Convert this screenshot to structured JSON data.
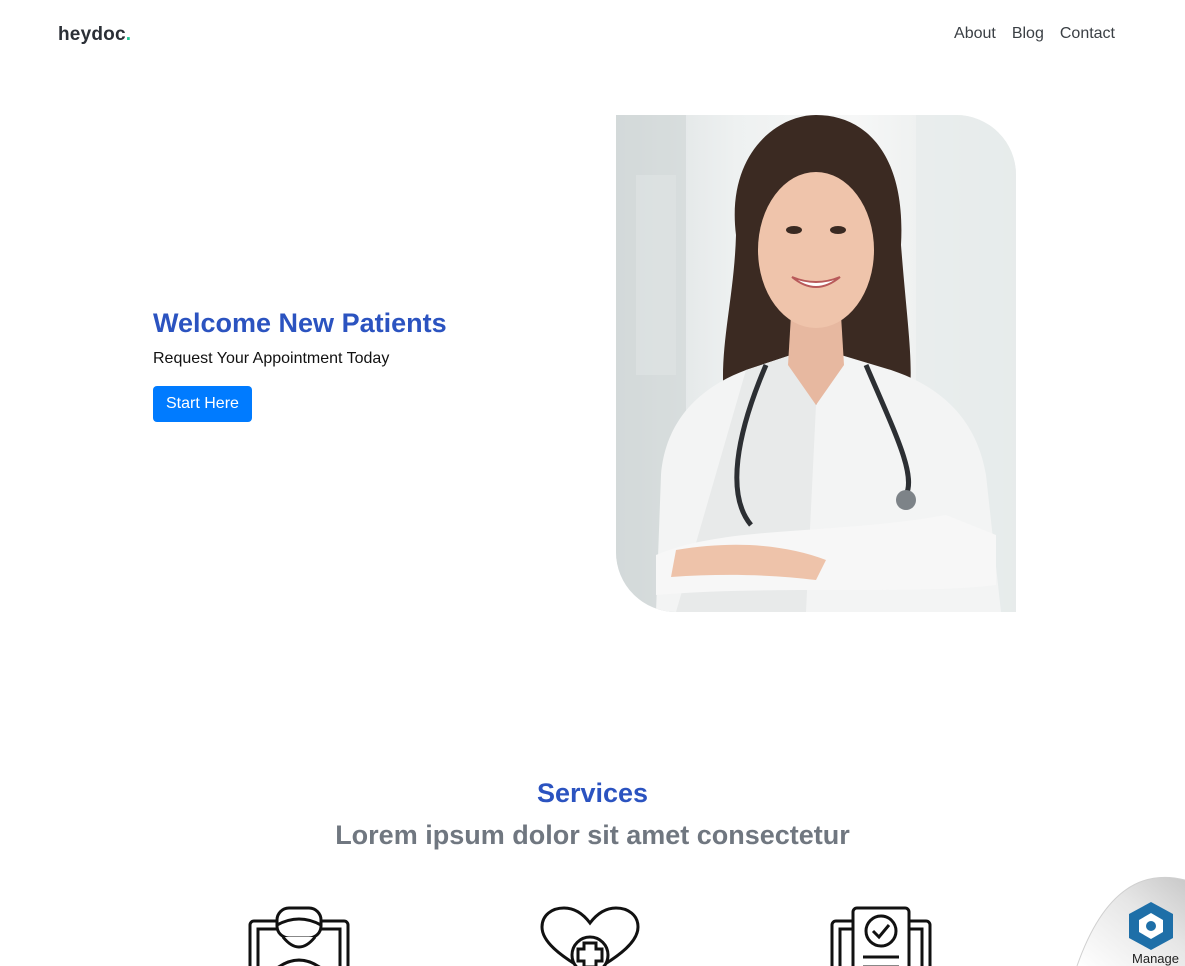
{
  "nav": {
    "brand": "heydoc",
    "brand_dot": ".",
    "links": [
      {
        "label": "About"
      },
      {
        "label": "Blog"
      },
      {
        "label": "Contact"
      }
    ]
  },
  "hero": {
    "title": "Welcome New Patients",
    "subtitle": "Request Your Appointment Today",
    "button_label": "Start Here"
  },
  "services": {
    "title": "Services",
    "subtitle": "Lorem ipsum dolor sit amet consectetur",
    "icons": [
      "doctor-tablet-icon",
      "heart-medical-icon",
      "clipboard-check-icon"
    ]
  },
  "widget": {
    "label": "Manage"
  },
  "colors": {
    "accent_blue": "#2b53c0",
    "button_blue": "#007bff",
    "brand_dot": "#20c997"
  }
}
